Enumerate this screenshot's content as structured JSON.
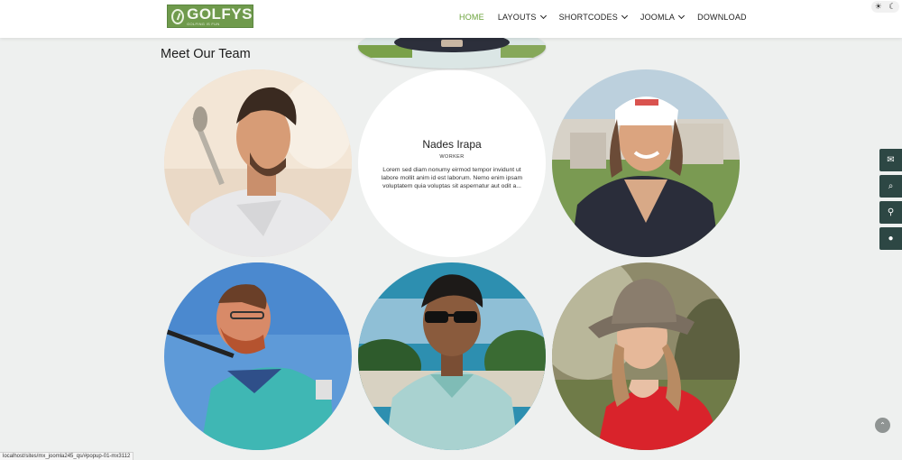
{
  "header": {
    "logo": {
      "word": "GOLFYS",
      "tagline": "GOLFING IS FUN"
    },
    "nav": [
      {
        "label": "HOME",
        "active": true,
        "dropdown": false
      },
      {
        "label": "LAYOUTS",
        "active": false,
        "dropdown": true
      },
      {
        "label": "SHORTCODES",
        "active": false,
        "dropdown": true
      },
      {
        "label": "JOOMLA",
        "active": false,
        "dropdown": true
      },
      {
        "label": "DOWNLOAD",
        "active": false,
        "dropdown": false
      }
    ],
    "theme_toggle": {
      "light_icon": "☀",
      "dark_icon": "☾"
    }
  },
  "section": {
    "title": "Meet Our Team"
  },
  "team": {
    "active_card": {
      "name": "Nades Irapa",
      "role": "WORKER",
      "bio": "Lorem sed diam nonumy eirmod tempor invidunt ut labore mollit anim id est laborum. Nemo enim ipsam voluptatem quia voluptas sit aspernatur aut odit a..."
    },
    "photos": [
      {
        "slot": "row1-left",
        "subject": "man-with-golf-club"
      },
      {
        "slot": "row1-right",
        "subject": "woman-with-visor"
      },
      {
        "slot": "row2-left",
        "subject": "bearded-man-swinging"
      },
      {
        "slot": "row2-center",
        "subject": "man-with-sunglasses"
      },
      {
        "slot": "row2-right",
        "subject": "woman-with-bucket-hat"
      }
    ]
  },
  "side_tools": [
    {
      "icon": "envelope-icon",
      "glyph": "✉"
    },
    {
      "icon": "search-icon",
      "glyph": "⌕"
    },
    {
      "icon": "map-pin-icon",
      "glyph": "⚲"
    },
    {
      "icon": "chat-icon",
      "glyph": "●"
    }
  ],
  "back_to_top": {
    "glyph": "⌃"
  },
  "status_url": "localhost/sites/mx_joomla245_qs/#popup-01-mx3112",
  "colors": {
    "accent": "#6aa23a",
    "tool_bg": "#2d4744",
    "page_bg": "#eef0ef"
  }
}
